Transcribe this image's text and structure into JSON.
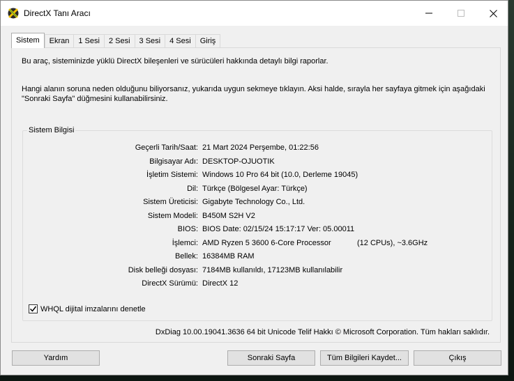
{
  "window": {
    "title": "DirectX Tanı Aracı",
    "icon": "directx-icon"
  },
  "tabs": [
    {
      "label": "Sistem",
      "active": true
    },
    {
      "label": "Ekran",
      "active": false
    },
    {
      "label": "1 Sesi",
      "active": false
    },
    {
      "label": "2 Sesi",
      "active": false
    },
    {
      "label": "3 Sesi",
      "active": false
    },
    {
      "label": "4 Sesi",
      "active": false
    },
    {
      "label": "Giriş",
      "active": false
    }
  ],
  "intro": {
    "line1": "Bu araç, sisteminizde yüklü DirectX bileşenleri ve sürücüleri hakkında detaylı bilgi raporlar.",
    "line2a": "Hangi alanın soruna neden olduğunu biliyorsanız, yukarıda uygun sekmeye tıklayın. Aksi halde, sırayla her sayfaya gitmek için aşağıdaki",
    "line2b": "\"Sonraki Sayfa\" düğmesini kullanabilirsiniz."
  },
  "system_info": {
    "group_label": "Sistem Bilgisi",
    "rows": [
      {
        "label": "Geçerli Tarih/Saat:",
        "value": "21 Mart 2024 Perşembe, 01:22:56"
      },
      {
        "label": "Bilgisayar Adı:",
        "value": "DESKTOP-OJUOTIK"
      },
      {
        "label": "İşletim Sistemi:",
        "value": "Windows 10 Pro 64 bit (10.0, Derleme 19045)"
      },
      {
        "label": "Dil:",
        "value": "Türkçe (Bölgesel Ayar: Türkçe)"
      },
      {
        "label": "Sistem Üreticisi:",
        "value": "Gigabyte Technology Co., Ltd."
      },
      {
        "label": "Sistem Modeli:",
        "value": "B450M S2H V2"
      },
      {
        "label": "BIOS:",
        "value": "BIOS Date: 02/15/24 15:17:17 Ver: 05.00011"
      },
      {
        "label": "İşlemci:",
        "value": "AMD Ryzen 5 3600 6-Core Processor",
        "extra": "(12 CPUs), ~3.6GHz"
      },
      {
        "label": "Bellek:",
        "value": "16384MB RAM"
      },
      {
        "label": "Disk belleği dosyası:",
        "value": "7184MB kullanıldı, 17123MB kullanılabilir"
      },
      {
        "label": "DirectX Sürümü:",
        "value": "DirectX 12"
      }
    ]
  },
  "whql": {
    "label": "WHQL dijital imzalarını denetle",
    "checked": true
  },
  "footer": "DxDiag 10.00.19041.3636 64 bit Unicode  Telif Hakkı © Microsoft Corporation. Tüm hakları saklıdır.",
  "buttons": {
    "help": "Yardım",
    "next": "Sonraki Sayfa",
    "save": "Tüm Bilgileri Kaydet...",
    "exit": "Çıkış"
  }
}
